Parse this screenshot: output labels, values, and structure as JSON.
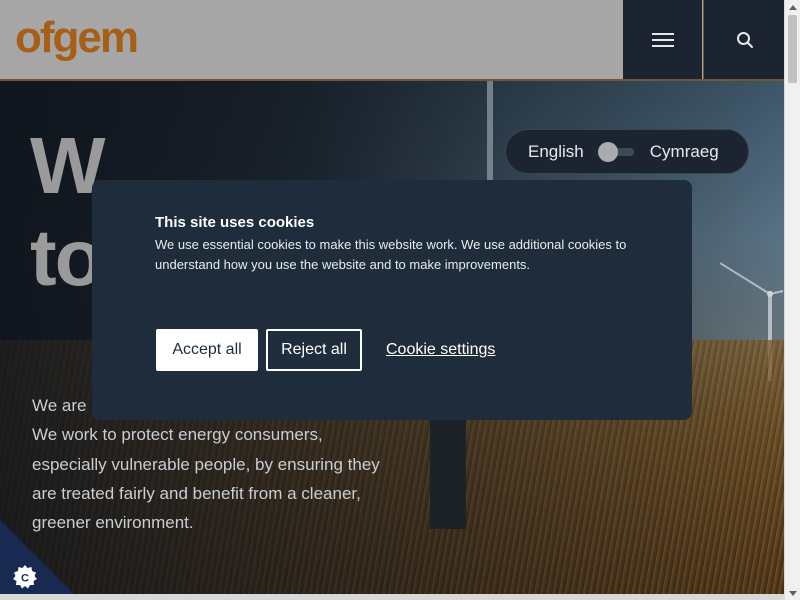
{
  "header": {
    "logo_text": "ofgem",
    "menu_icon": "hamburger-menu-icon",
    "search_icon": "search-icon"
  },
  "language_toggle": {
    "left_label": "English",
    "right_label": "Cymraeg",
    "selected": "English"
  },
  "hero": {
    "title_line1": "W",
    "title_line2": "to",
    "text_line1": "We are",
    "text_rest": "We work to protect energy consumers, especially vulnerable people, by ensuring they are treated fairly and benefit from a cleaner, greener environment."
  },
  "cookie_banner": {
    "title": "This site uses cookies",
    "body": "We use essential cookies to make this website work. We use additional cookies to understand how you use the website and to make improvements.",
    "accept_label": "Accept all",
    "reject_label": "Reject all",
    "settings_label": "Cookie settings"
  },
  "cookie_corner": {
    "icon": "cookie-settings-icon",
    "letter": "C"
  },
  "colors": {
    "brand_orange": "#a65f17",
    "header_bg": "#a6a6a6",
    "nav_dark": "#1b2430",
    "banner_bg": "#1f2c3b",
    "corner_bg": "#182a52"
  }
}
